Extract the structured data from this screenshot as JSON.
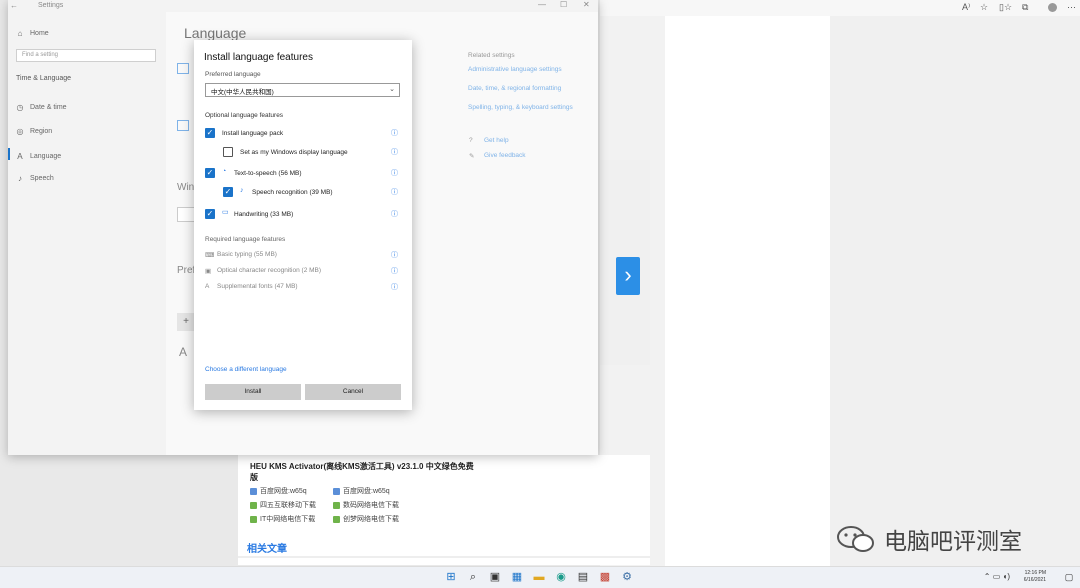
{
  "settings": {
    "window_title": "Settings",
    "titlebar_buttons": [
      "—",
      "☐",
      "✕"
    ],
    "home": "Home",
    "search_placeholder": "Find a setting",
    "category": "Time & Language",
    "nav": [
      "Date & time",
      "Region",
      "Language",
      "Speech"
    ],
    "page_title": "Language"
  },
  "dialog": {
    "title": "Install language features",
    "preferred_label": "Preferred language",
    "preferred_value": "中文(中华人民共和国)",
    "optional_label": "Optional language features",
    "optional": [
      {
        "label": "Install language pack",
        "checked": true
      },
      {
        "label": "Set as my Windows display language",
        "checked": false
      },
      {
        "label": "Text-to-speech (56 MB)",
        "checked": true
      },
      {
        "label": "Speech recognition (39 MB)",
        "checked": true
      },
      {
        "label": "Handwriting (33 MB)",
        "checked": true
      }
    ],
    "required_label": "Required language features",
    "required": [
      "Basic typing (55 MB)",
      "Optical character recognition (2 MB)",
      "Supplemental fonts (47 MB)"
    ],
    "choose_link": "Choose a different language",
    "install_button": "Install",
    "cancel_button": "Cancel"
  },
  "related": {
    "title": "Related settings",
    "links": [
      "Administrative language settings",
      "Date, time, & regional formatting",
      "Spelling, typing, & keyboard settings"
    ],
    "help": "Get help",
    "feedback": "Give feedback"
  },
  "article": {
    "title": "HEU KMS Activator(离线KMS激活工具) v23.1.0 中文绿色免费版",
    "downloads": [
      [
        "百度网盘:w65q",
        "百度网盘:w65q"
      ],
      [
        "四五互联移动下载",
        "数码网络电信下载"
      ],
      [
        "IT中网络电信下载",
        "创梦网络电信下载"
      ]
    ],
    "related_title": "相关文章"
  },
  "taskbar": {
    "time": "12:16 PM",
    "date": "6/16/2021"
  },
  "watermark": {
    "text": "电脑吧评测室"
  },
  "colors": {
    "accent": "#1a73c9",
    "link": "#2a7ae2",
    "next_button": "#2c8fe6"
  }
}
